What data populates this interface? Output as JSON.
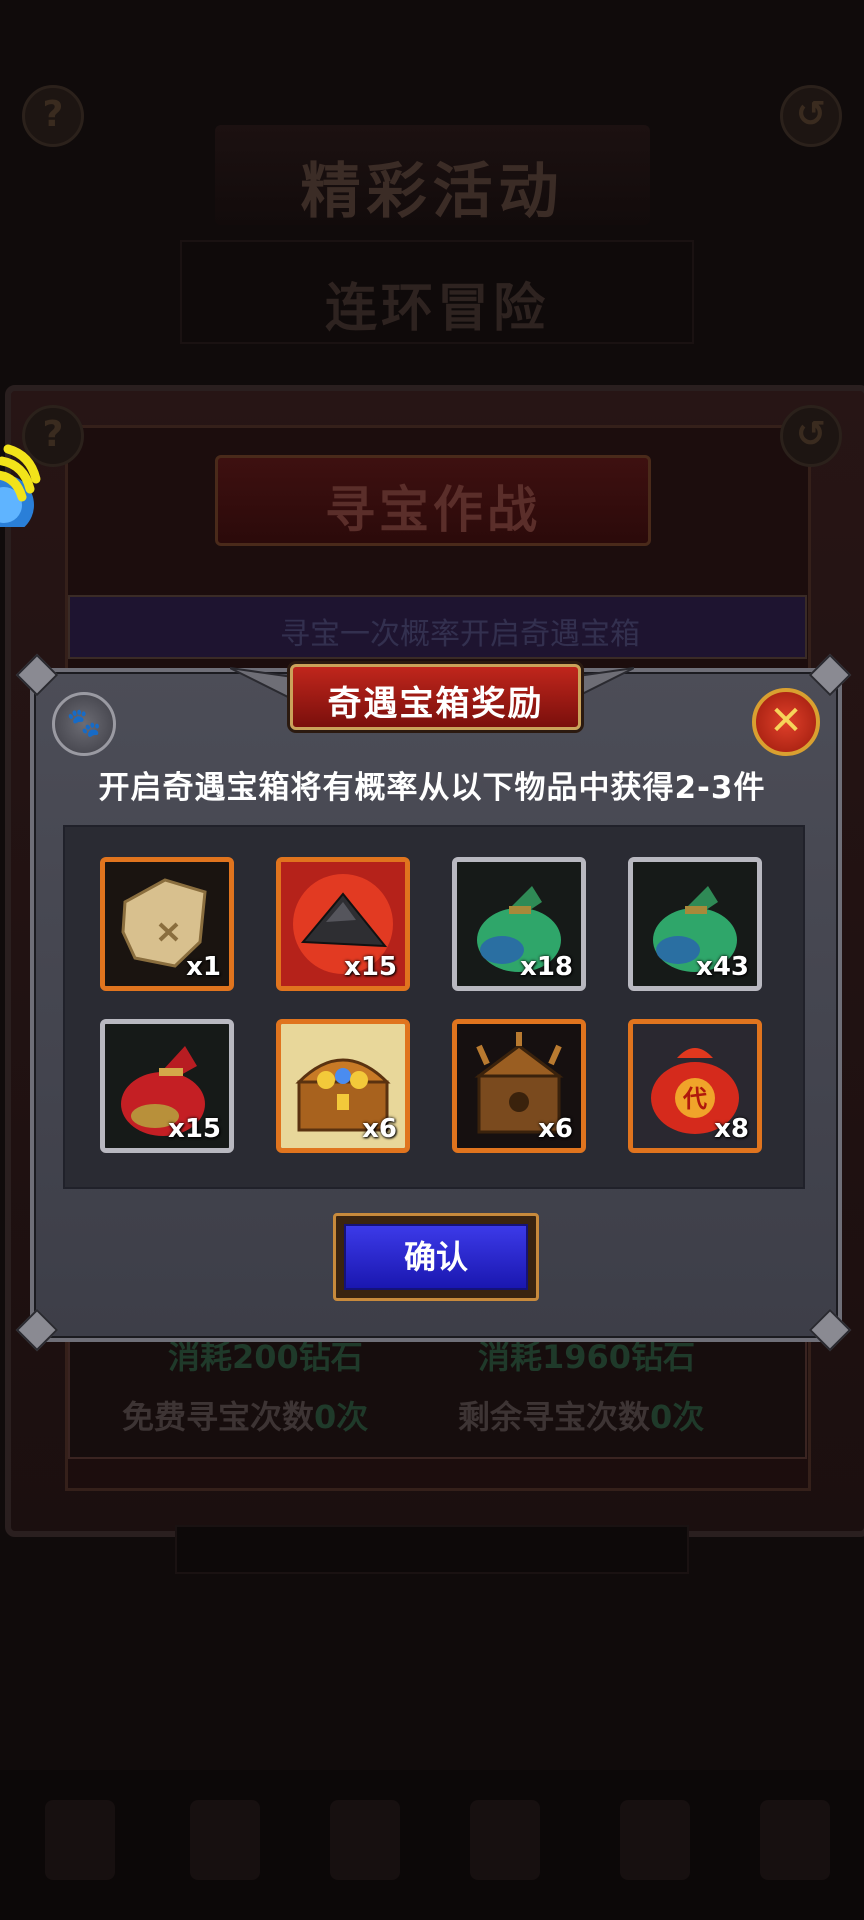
{
  "background": {
    "event_title": "精彩活动",
    "event_subtitle": "连环冒险",
    "panel_title": "寻宝作战",
    "info_text": "寻宝一次概率开启奇遇宝箱",
    "cost_left": "消耗200钻石",
    "cost_right": "消耗1960钻石",
    "free_count_label": "免费寻宝次数",
    "free_count_value": "0次",
    "remaining_count_label": "剩余寻宝次数",
    "remaining_count_value": "0次",
    "help_icon": "question-icon",
    "back_icon": "back-arrow-icon"
  },
  "dialog": {
    "title": "奇遇宝箱奖励",
    "description": "开启奇遇宝箱将有概率从以下物品中获得2-3件",
    "confirm_label": "确认",
    "close_icon": "close-x-icon",
    "paw_icon": "paw-icon",
    "items": [
      {
        "name": "treasure-map",
        "quantity": "x1",
        "rarity": "orange"
      },
      {
        "name": "ore-pile",
        "quantity": "x15",
        "rarity": "orange"
      },
      {
        "name": "green-pouch",
        "quantity": "x18",
        "rarity": "gray"
      },
      {
        "name": "green-pouch",
        "quantity": "x43",
        "rarity": "gray"
      },
      {
        "name": "red-pouch",
        "quantity": "x15",
        "rarity": "gray"
      },
      {
        "name": "gold-chest",
        "quantity": "x6",
        "rarity": "orange"
      },
      {
        "name": "bronze-chest",
        "quantity": "x6",
        "rarity": "orange"
      },
      {
        "name": "red-lucky-bag",
        "quantity": "x8",
        "rarity": "orange"
      }
    ]
  },
  "colors": {
    "orange_border": "#e0741e",
    "gray_border": "#b8b8c0",
    "confirm_blue": "#2a27d0",
    "title_red": "#b0201a"
  }
}
